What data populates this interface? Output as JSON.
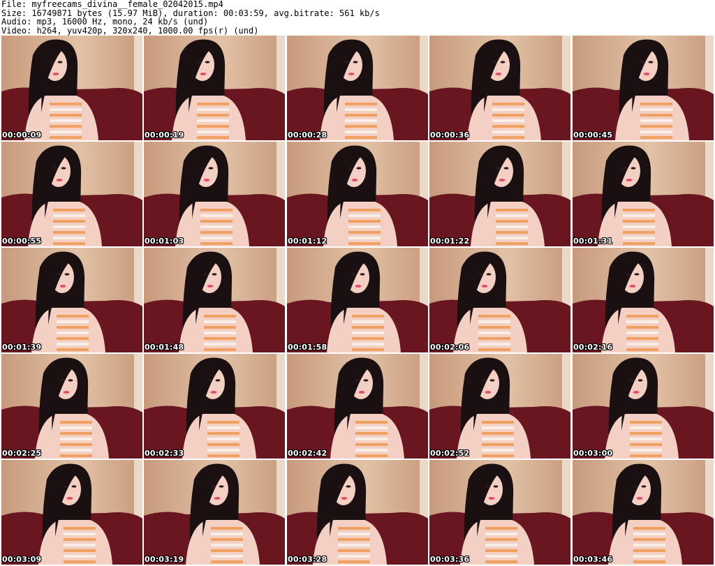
{
  "header": {
    "file_line": "File: myfreecams_divina__female_02042015.mp4",
    "size_line": "Size: 16749871 bytes (15.97 MiB), duration: 00:03:59, avg.bitrate: 561 kb/s",
    "audio_line": "Audio: mp3, 16000 Hz, mono, 24 kb/s (und)",
    "video_line": "Video: h264, yuv420p, 320x240, 1000.00 fps(r) (und)"
  },
  "grid": {
    "columns": 5,
    "thumbnails": [
      {
        "timestamp": "00:00:09"
      },
      {
        "timestamp": "00:00:19"
      },
      {
        "timestamp": "00:00:28"
      },
      {
        "timestamp": "00:00:36"
      },
      {
        "timestamp": "00:00:45"
      },
      {
        "timestamp": "00:00:55"
      },
      {
        "timestamp": "00:01:03"
      },
      {
        "timestamp": "00:01:12"
      },
      {
        "timestamp": "00:01:22"
      },
      {
        "timestamp": "00:01:31"
      },
      {
        "timestamp": "00:01:39"
      },
      {
        "timestamp": "00:01:48"
      },
      {
        "timestamp": "00:01:58"
      },
      {
        "timestamp": "00:02:06"
      },
      {
        "timestamp": "00:02:16"
      },
      {
        "timestamp": "00:02:25"
      },
      {
        "timestamp": "00:02:33"
      },
      {
        "timestamp": "00:02:42"
      },
      {
        "timestamp": "00:02:52"
      },
      {
        "timestamp": "00:03:00"
      },
      {
        "timestamp": "00:03:09"
      },
      {
        "timestamp": "00:03:19"
      },
      {
        "timestamp": "00:03:28"
      },
      {
        "timestamp": "00:03:36"
      },
      {
        "timestamp": "00:03:46"
      }
    ]
  },
  "colors": {
    "wall": "#c89a7d",
    "wall_light": "#e2c2a6",
    "couch": "#6a1620",
    "hair": "#1a1012",
    "skin": "#f4cfc4",
    "top_stripe_orange": "#f0a060",
    "top_stripe_white": "#f8f0e6",
    "timestamp_text": "#ffffff"
  }
}
